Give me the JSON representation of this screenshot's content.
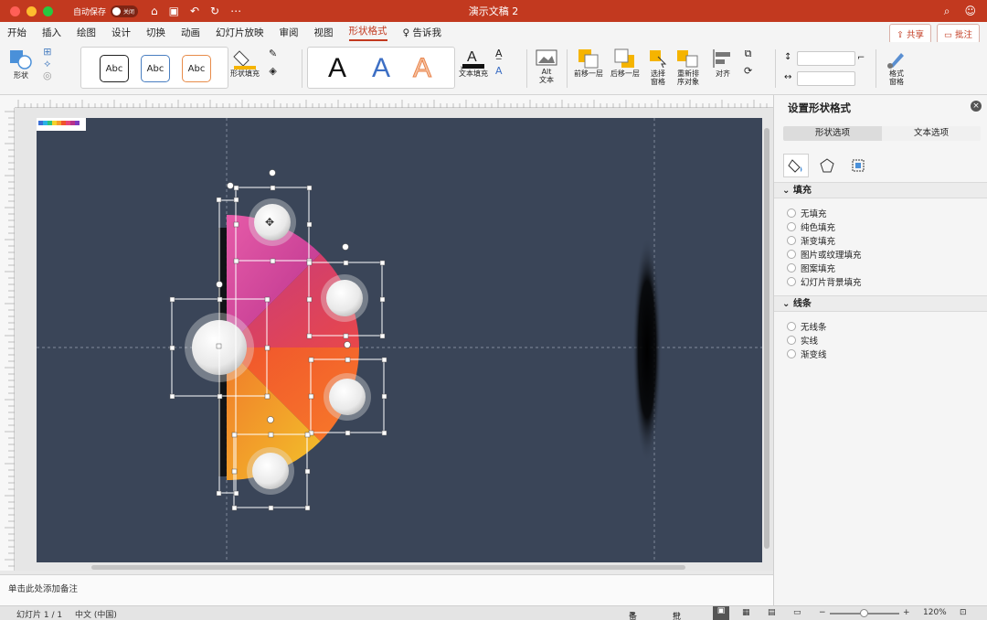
{
  "titlebar": {
    "autosave_label": "自动保存",
    "autosave_state": "关闭",
    "doc_title": "演示文稿 2"
  },
  "tabs": [
    {
      "label": "开始",
      "active": false
    },
    {
      "label": "插入",
      "active": false
    },
    {
      "label": "绘图",
      "active": false
    },
    {
      "label": "设计",
      "active": false
    },
    {
      "label": "切换",
      "active": false
    },
    {
      "label": "动画",
      "active": false
    },
    {
      "label": "幻灯片放映",
      "active": false
    },
    {
      "label": "审阅",
      "active": false
    },
    {
      "label": "视图",
      "active": false
    },
    {
      "label": "形状格式",
      "active": true
    },
    {
      "label": "告诉我",
      "active": false
    }
  ],
  "share": {
    "share_label": "共享",
    "comment_label": "批注"
  },
  "ribbon": {
    "shapes_label": "形状",
    "style_samples": [
      "Abc",
      "Abc",
      "Abc"
    ],
    "shape_fill_label": "形状填充",
    "wordart_samples": [
      "A",
      "A",
      "A"
    ],
    "text_fill_label": "文本填充",
    "alt_text_label": "Alt\n文本",
    "bring_forward_label": "前移一层",
    "send_backward_label": "后移一层",
    "selection_pane_label": "选择\n窗格",
    "reorder_label": "重新排\n序对象",
    "align_label": "对齐",
    "format_pane_label": "格式\n窗格"
  },
  "notes": {
    "placeholder": "单击此处添加备注"
  },
  "panel": {
    "title": "设置形状格式",
    "tab_shape": "形状选项",
    "tab_text": "文本选项",
    "fill_section": "填充",
    "fill_options": [
      "无填充",
      "纯色填充",
      "渐变填充",
      "图片或纹理填充",
      "图案填充",
      "幻灯片背景填充"
    ],
    "line_section": "线条",
    "line_options": [
      "无线条",
      "实线",
      "渐变线"
    ]
  },
  "status": {
    "slide_info": "幻灯片 1 / 1",
    "language": "中文 (中国)",
    "notes_label": "备注",
    "comments_label": "批注",
    "zoom": "120%"
  },
  "colors": {
    "accent": "#c2391f",
    "slide_bg": "#3a4558",
    "segment_magenta": "#d8449e",
    "segment_crimson": "#d23e5c",
    "segment_orange": "#f0542c",
    "segment_amber": "#f3a32a"
  }
}
